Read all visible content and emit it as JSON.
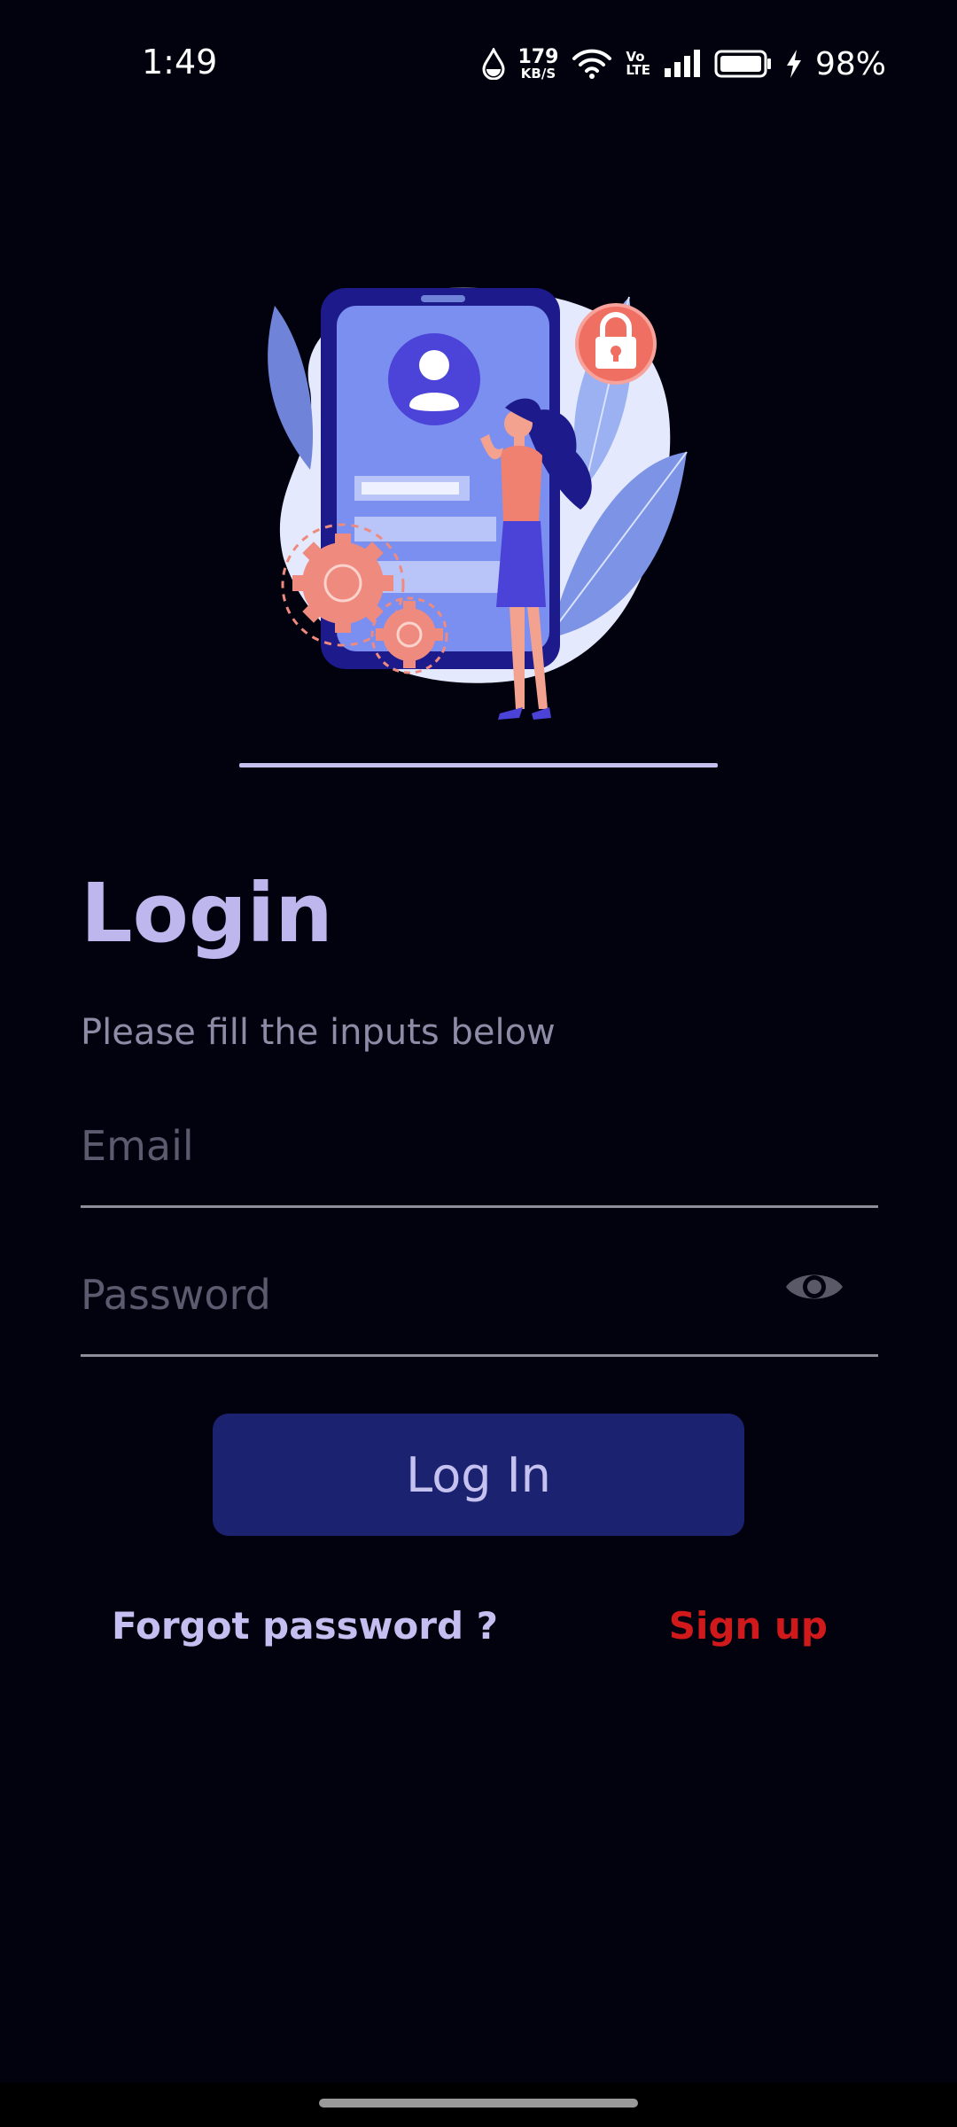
{
  "status_bar": {
    "time": "1:49",
    "net_speed_value": "179",
    "net_speed_unit": "KB/S",
    "volte_top": "Vo",
    "volte_bottom": "LTE",
    "battery_percent": "98%"
  },
  "login": {
    "title": "Login",
    "subtitle": "Please fill the inputs below",
    "email_placeholder": "Email",
    "email_value": "",
    "password_placeholder": "Password",
    "password_value": "",
    "login_button": "Log In",
    "forgot_password": "Forgot password ?",
    "sign_up": "Sign up"
  },
  "colors": {
    "background": "#02020f",
    "accent": "#bdb7ee",
    "button": "#1b2270",
    "signup": "#d0191b"
  },
  "icons": [
    "water-drop-icon",
    "wifi-icon",
    "signal-icon",
    "battery-icon",
    "charging-bolt-icon",
    "eye-icon",
    "lock-icon",
    "gear-icon",
    "user-icon"
  ]
}
